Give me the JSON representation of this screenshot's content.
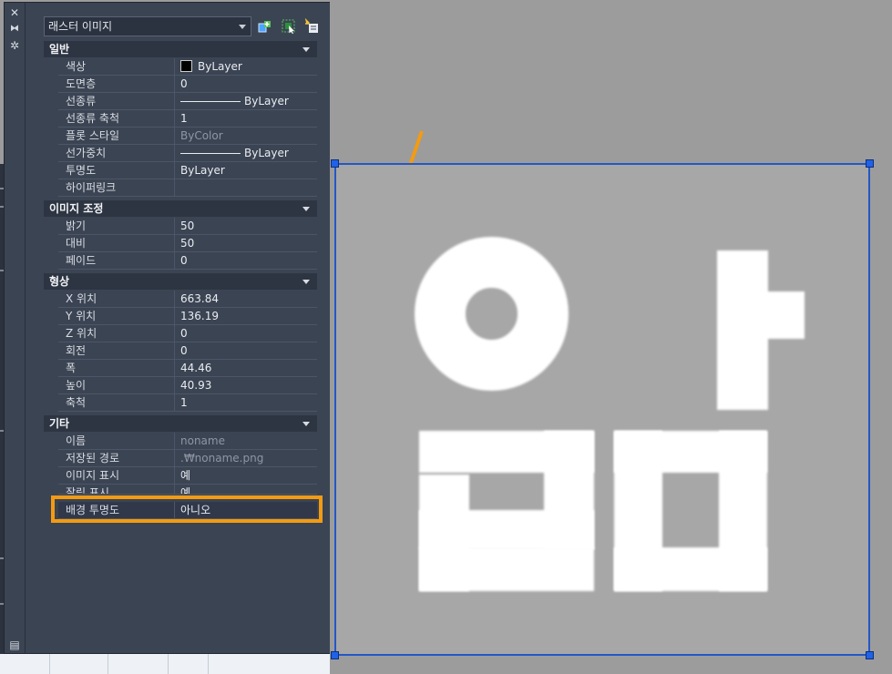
{
  "palette": {
    "selector_value": "래스터 이미지",
    "sections": {
      "general": {
        "title": "일반",
        "rows": [
          {
            "name": "색상",
            "value": "ByLayer"
          },
          {
            "name": "도면층",
            "value": "0"
          },
          {
            "name": "선종류",
            "value": "ByLayer"
          },
          {
            "name": "선종류 축척",
            "value": "1"
          },
          {
            "name": "플롯 스타일",
            "value": "ByColor"
          },
          {
            "name": "선가중치",
            "value": "ByLayer"
          },
          {
            "name": "투명도",
            "value": "ByLayer"
          },
          {
            "name": "하이퍼링크",
            "value": ""
          }
        ]
      },
      "adjust": {
        "title": "이미지 조정",
        "rows": [
          {
            "name": "밝기",
            "value": "50"
          },
          {
            "name": "대비",
            "value": "50"
          },
          {
            "name": "페이드",
            "value": "0"
          }
        ]
      },
      "geometry": {
        "title": "형상",
        "rows": [
          {
            "name": "X 위치",
            "value": "663.84"
          },
          {
            "name": "Y 위치",
            "value": "136.19"
          },
          {
            "name": "Z 위치",
            "value": "0"
          },
          {
            "name": "회전",
            "value": "0"
          },
          {
            "name": "폭",
            "value": "44.46"
          },
          {
            "name": "높이",
            "value": "40.93"
          },
          {
            "name": "축척",
            "value": "1"
          }
        ]
      },
      "misc": {
        "title": "기타",
        "rows": [
          {
            "name": "이름",
            "value": "noname"
          },
          {
            "name": "저장된 경로",
            "value": ".₩noname.png"
          },
          {
            "name": "이미지 표시",
            "value": "예"
          },
          {
            "name": "잘림 표시",
            "value": "예"
          },
          {
            "name": "배경 투명도",
            "value": "아니오"
          }
        ]
      }
    }
  },
  "icons": {
    "close": "close-icon",
    "autohide": "autohide-icon",
    "settings": "settings-icon",
    "quick_select": "quick-select-icon",
    "select_objects": "select-objects-icon",
    "pickadd": "pickadd-toggle-icon"
  },
  "colors": {
    "highlight": "#f39b12",
    "selection": "#2457c6",
    "arrow": "#f39b12"
  }
}
